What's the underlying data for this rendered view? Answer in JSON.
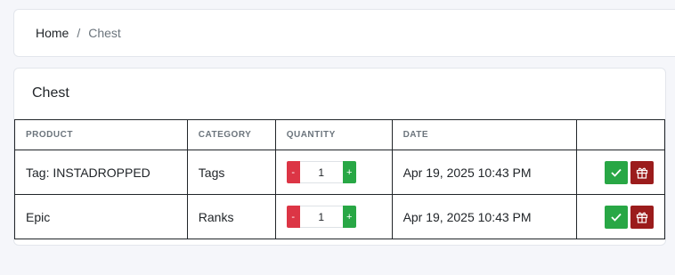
{
  "breadcrumb": {
    "home": "Home",
    "separator": "/",
    "current": "Chest"
  },
  "card": {
    "title": "Chest"
  },
  "table": {
    "headers": {
      "product": "PRODUCT",
      "category": "CATEGORY",
      "quantity": "QUANTITY",
      "date": "DATE",
      "actions": ""
    },
    "rows": [
      {
        "product": "Tag: INSTADROPPED",
        "category": "Tags",
        "quantity": "1",
        "date": "Apr 19, 2025 10:43 PM"
      },
      {
        "product": "Epic",
        "category": "Ranks",
        "quantity": "1",
        "date": "Apr 19, 2025 10:43 PM"
      }
    ]
  },
  "controls": {
    "minus_label": "-",
    "plus_label": "+"
  },
  "icons": {
    "claim": "check-icon",
    "gift": "gift-icon"
  },
  "colors": {
    "minus": "#dc3545",
    "plus": "#28a745",
    "claim": "#28a745",
    "gift": "#9b1c1c",
    "background": "#f5f6fa"
  }
}
